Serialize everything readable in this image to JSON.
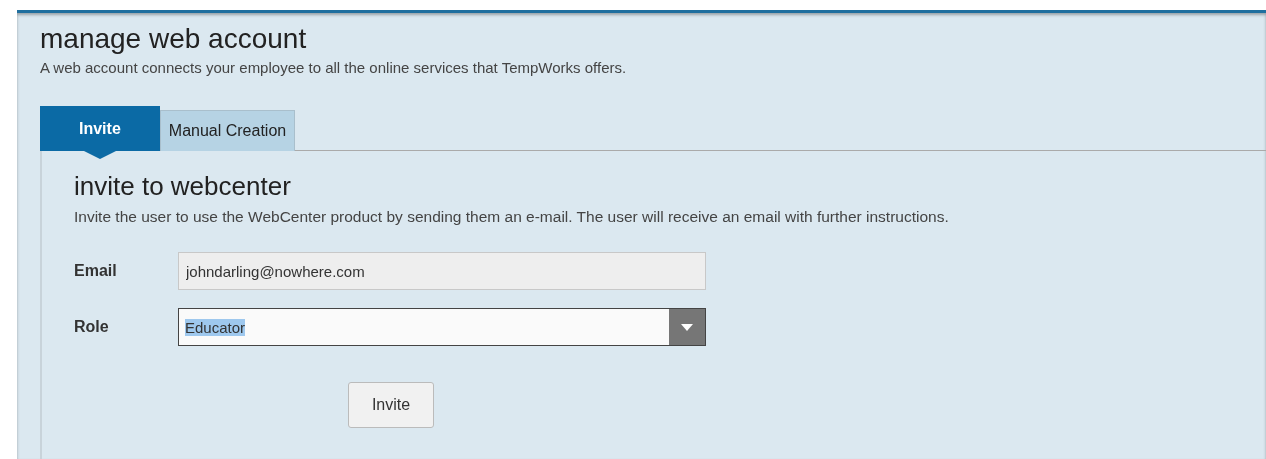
{
  "page": {
    "title": "manage web account",
    "subtitle": "A web account connects your employee to all the online services that TempWorks offers."
  },
  "tabs": [
    {
      "label": "Invite",
      "selected": true
    },
    {
      "label": "Manual Creation",
      "selected": false
    }
  ],
  "section": {
    "title": "invite to webcenter",
    "description": "Invite the user to use the WebCenter product by sending them an e-mail. The user will receive an email with further instructions."
  },
  "form": {
    "email": {
      "label": "Email",
      "value": "johndarling@nowhere.com"
    },
    "role": {
      "label": "Role",
      "value": "Educator",
      "text_selected": true
    }
  },
  "buttons": [
    {
      "label": "Invite"
    }
  ]
}
